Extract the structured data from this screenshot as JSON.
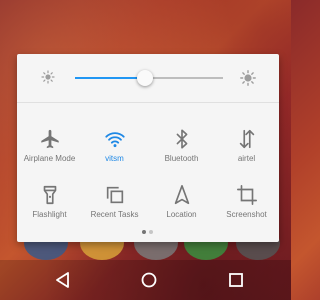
{
  "quick_settings": {
    "brightness": {
      "level": 0.47,
      "low_icon": "brightness-low-icon",
      "high_icon": "brightness-high-icon",
      "accent_color": "#2196f3"
    },
    "tiles": [
      {
        "label": "Airplane Mode",
        "icon": "airplane-icon",
        "active": false
      },
      {
        "label": "vitsm",
        "icon": "wifi-icon",
        "active": true
      },
      {
        "label": "Bluetooth",
        "icon": "bluetooth-icon",
        "active": false
      },
      {
        "label": "airtel",
        "icon": "mobile-data-icon",
        "active": false
      },
      {
        "label": "Flashlight",
        "icon": "flashlight-icon",
        "active": false
      },
      {
        "label": "Recent Tasks",
        "icon": "recent-tasks-icon",
        "active": false
      },
      {
        "label": "Location",
        "icon": "location-icon",
        "active": false
      },
      {
        "label": "Screenshot",
        "icon": "screenshot-icon",
        "active": false
      }
    ],
    "page_indicator": {
      "pages": 2,
      "current": 0
    }
  },
  "navigation_bar": {
    "buttons": [
      "back-icon",
      "home-icon",
      "recents-icon"
    ]
  },
  "colors": {
    "panel_bg": "#f5f5f5",
    "active_tile": "#1e88e5",
    "inactive_tile": "#757575"
  }
}
